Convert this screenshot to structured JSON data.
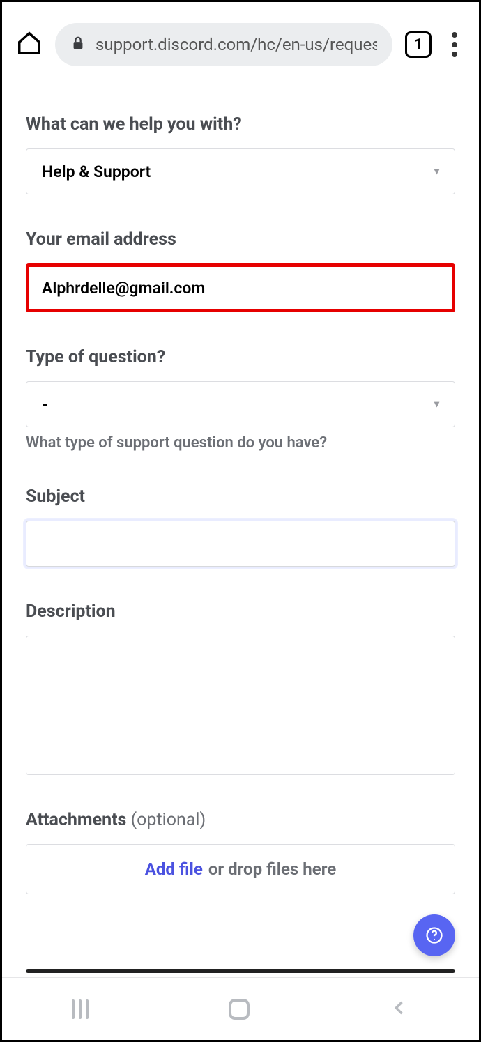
{
  "browser": {
    "url": "support.discord.com/hc/en-us/reques",
    "tabCount": "1"
  },
  "form": {
    "helpWith": {
      "label": "What can we help you with?",
      "value": "Help & Support"
    },
    "email": {
      "label": "Your email address",
      "value": "Alphrdelle@gmail.com"
    },
    "questionType": {
      "label": "Type of question?",
      "value": "-",
      "hint": "What type of support question do you have?"
    },
    "subject": {
      "label": "Subject",
      "value": ""
    },
    "description": {
      "label": "Description",
      "value": ""
    },
    "attachments": {
      "label": "Attachments",
      "optional": "(optional)",
      "addFile": "Add file",
      "dropText": " or drop files here"
    }
  }
}
